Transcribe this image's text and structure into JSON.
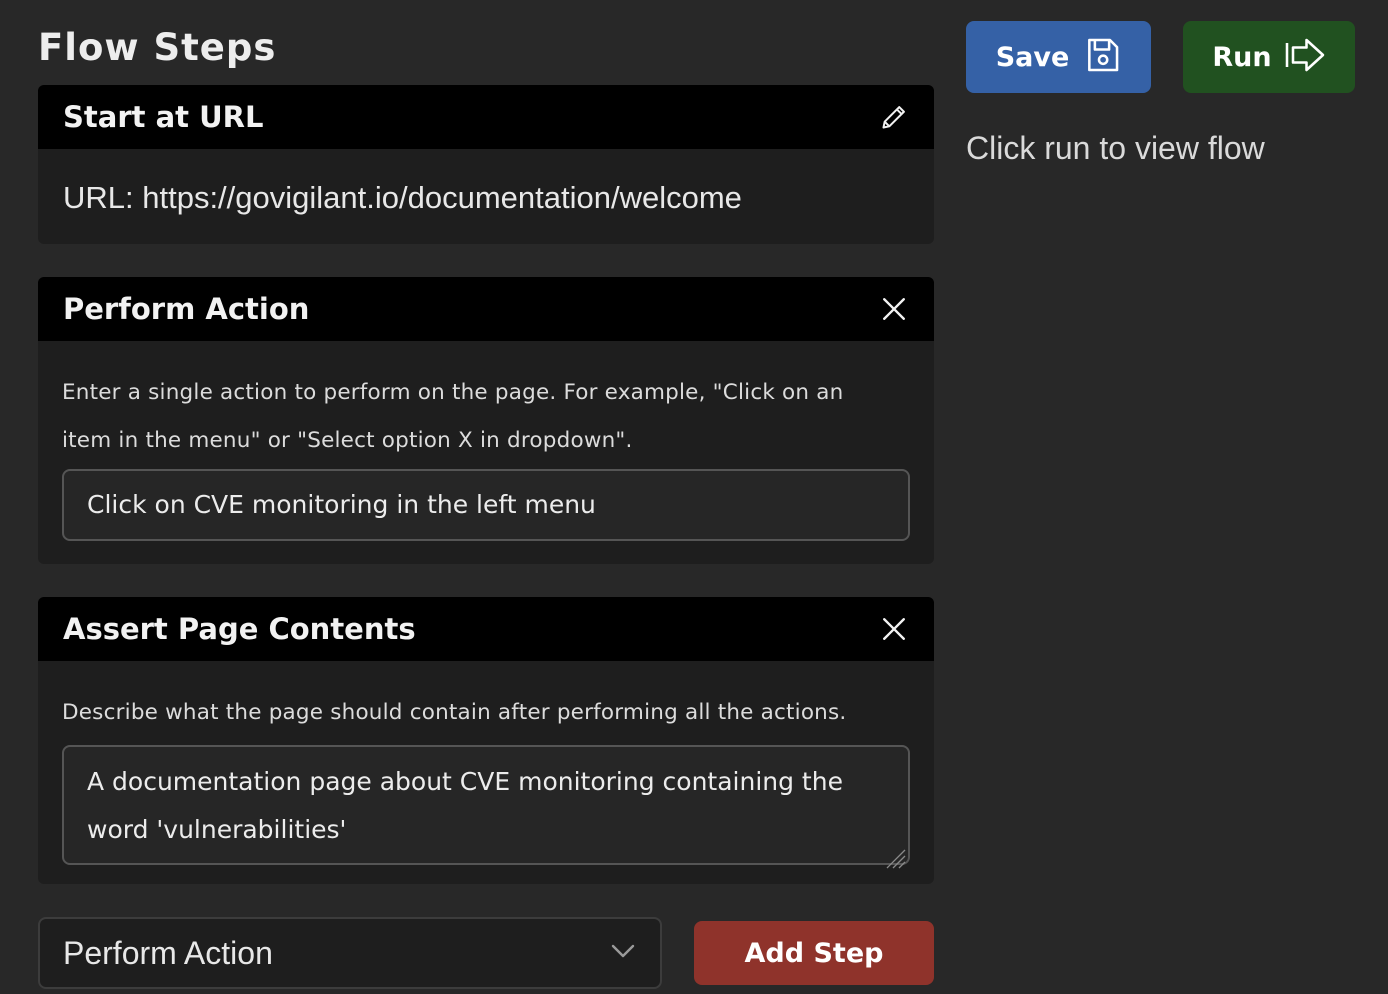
{
  "page": {
    "title": "Flow Steps"
  },
  "toolbar": {
    "save_label": "Save",
    "run_label": "Run",
    "hint": "Click run to view flow"
  },
  "steps": [
    {
      "title": "Start at URL",
      "icon": "pencil-icon",
      "url_line": "URL: https://govigilant.io/documentation/welcome"
    },
    {
      "title": "Perform Action",
      "icon": "close-icon",
      "description_line1": "Enter a single action to perform on the page. For example, \"Click on an",
      "description_line2": "item in the menu\" or \"Select option X in dropdown\".",
      "value": "Click on CVE monitoring in the left menu"
    },
    {
      "title": "Assert Page Contents",
      "icon": "close-icon",
      "description": "Describe what the page should contain after performing all the actions.",
      "value_line1": "A documentation page about CVE monitoring containing the",
      "value_line2": "word 'vulnerabilities'"
    }
  ],
  "footer": {
    "step_type_selected": "Perform Action",
    "add_step_label": "Add Step"
  },
  "colors": {
    "background": "#282828",
    "card_header": "#000000",
    "save_button": "#3561a6",
    "run_button": "#215120",
    "add_step_button": "#8f332b"
  }
}
